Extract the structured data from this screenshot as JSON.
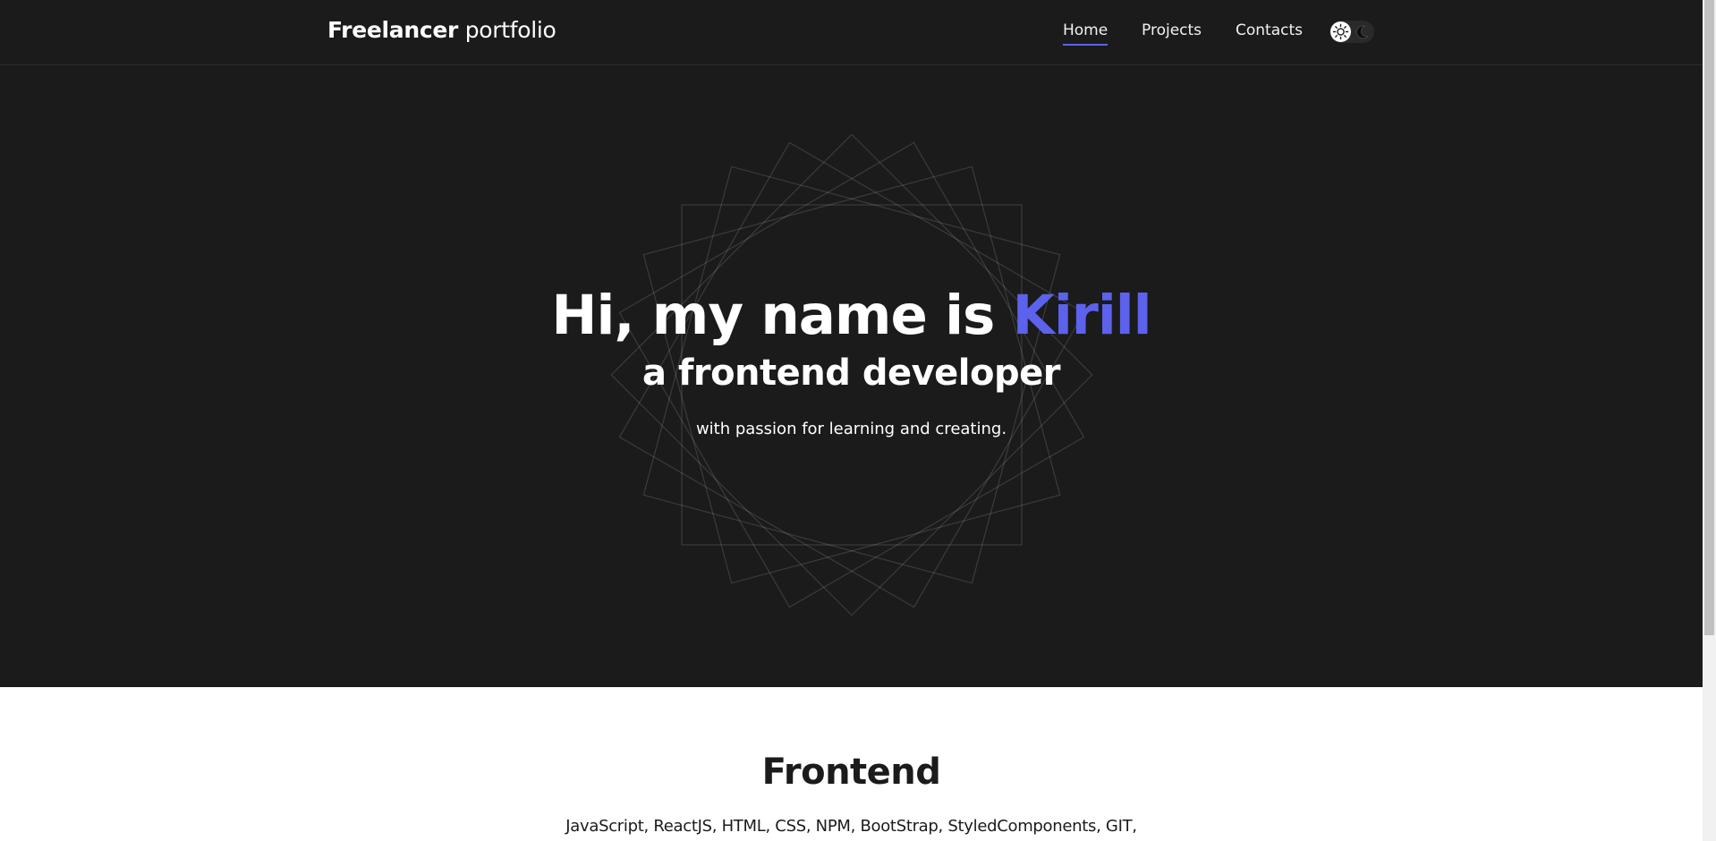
{
  "header": {
    "logo_bold": "Freelancer",
    "logo_light": "portfolio",
    "nav": [
      {
        "label": "Home",
        "active": true
      },
      {
        "label": "Projects",
        "active": false
      },
      {
        "label": "Contacts",
        "active": false
      }
    ],
    "theme_toggle": {
      "left_icon": "sun-icon",
      "right_icon": "moon-icon",
      "selected": "light"
    }
  },
  "hero": {
    "title_prefix": "Hi, my name is",
    "title_name": "Kirill",
    "subtitle": "a frontend developer",
    "tagline": "with passion for learning and creating."
  },
  "section": {
    "title": "Frontend",
    "skills": "JavaScript, ReactJS, HTML, CSS, NPM, BootStrap, StyledComponents, GIT,"
  },
  "colors": {
    "dark_background": "#1b1b1b",
    "accent": "#5c62ec",
    "text_light": "#ffffff",
    "text_dark": "#1b1b1b"
  }
}
